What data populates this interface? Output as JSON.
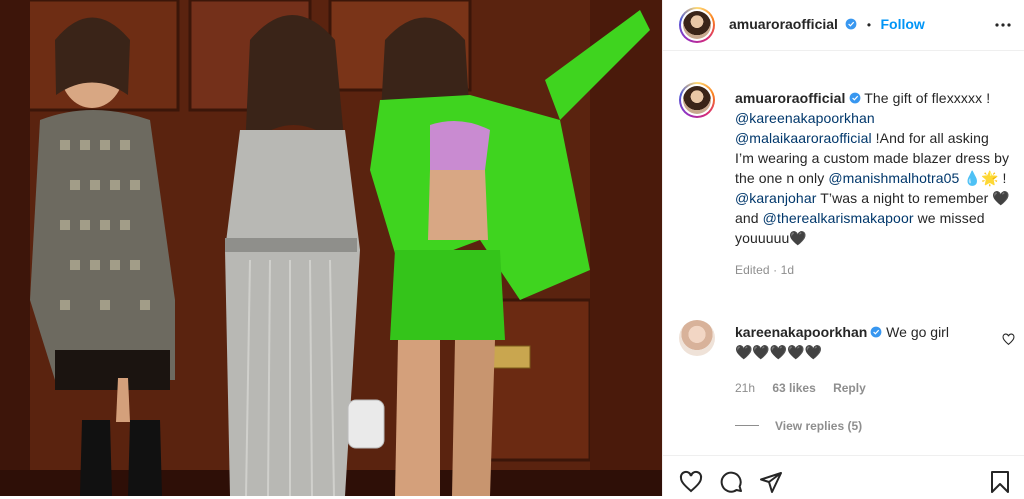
{
  "post": {
    "photo_icon": "post-photo",
    "header": {
      "username": "amuaroraofficial",
      "separator": "•",
      "follow_label": "Follow",
      "verified_icon": "verified-badge-icon",
      "more_icon": "more-options-icon"
    },
    "caption": {
      "username": "amuaroraofficial",
      "text_1": " The gift of flexxxxx !",
      "mention_1": "@kareenakapoorkhan",
      "mention_2": "@malaikaaroraofficial",
      "text_2": " !And for all asking I’m wearing a custom made blazer dress by the one n only ",
      "mention_3": "@manishmalhotra05",
      "text_3": " 💧🌟 ! ",
      "mention_4": "@karanjohar",
      "text_4": " T’was a night to remember 🖤 and ",
      "mention_5": "@therealkarismakapoor",
      "text_5": " we missed youuuuu🖤",
      "edited": "Edited",
      "time": "1d"
    },
    "comment": {
      "username": "kareenakapoorkhan",
      "text": " We go girl",
      "hearts": "🖤🖤🖤🖤🖤",
      "time": "21h",
      "likes": "63 likes",
      "reply_label": "Reply",
      "view_replies": "View replies (5)"
    },
    "actions": {
      "like_icon": "heart-icon",
      "comment_icon": "comment-icon",
      "share_icon": "share-icon",
      "save_icon": "bookmark-icon"
    },
    "colors": {
      "link": "#0095f6",
      "mention": "#00376b",
      "muted": "#8e8e8e",
      "blazer_green": "#3fd41f"
    }
  }
}
